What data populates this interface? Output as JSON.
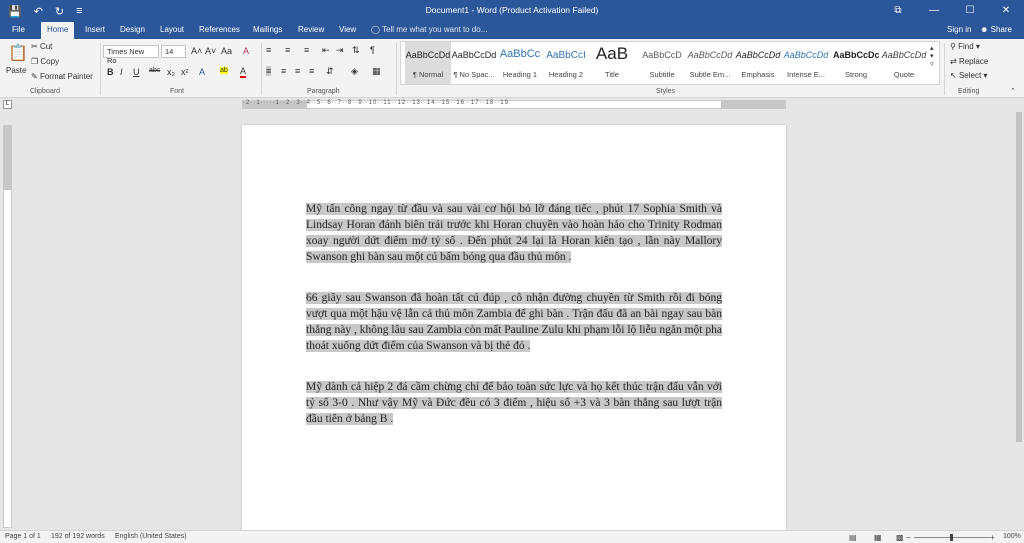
{
  "window": {
    "title": "Document1 - Word (Product Activation Failed)",
    "qat": {
      "save_icon": "💾",
      "undo_icon": "↶",
      "redo_icon": "↻",
      "customize_icon": "≡"
    },
    "controls": {
      "ribbon_display": "⧉",
      "minimize": "—",
      "maximize": "☐",
      "close": "✕"
    }
  },
  "tabs": [
    "File",
    "Home",
    "Insert",
    "Design",
    "Layout",
    "References",
    "Mailings",
    "Review",
    "View"
  ],
  "tell_me": "Tell me what you want to do...",
  "sign_in": "Sign in",
  "share": "Share",
  "clipboard": {
    "paste": "Paste",
    "cut": "Cut",
    "copy": "Copy",
    "format_painter": "Format Painter",
    "group": "Clipboard"
  },
  "font": {
    "name": "Times New Ro",
    "size": "14",
    "group": "Font",
    "bold": "B",
    "italic": "I",
    "underline": "U",
    "strike": "abc",
    "subscript": "x₂",
    "superscript": "x²",
    "grow": "A˄",
    "shrink": "A˅",
    "case": "Aa",
    "clear": "A",
    "effects": "A",
    "highlight": "ab",
    "color": "A"
  },
  "paragraph": {
    "group": "Paragraph",
    "show_marks": "¶"
  },
  "styles": {
    "group": "Styles",
    "items": [
      {
        "preview": "AaBbCcDd",
        "label": "¶ Normal"
      },
      {
        "preview": "AaBbCcDd",
        "label": "¶ No Spac..."
      },
      {
        "preview": "AaBbCc",
        "label": "Heading 1"
      },
      {
        "preview": "AaBbCcI",
        "label": "Heading 2"
      },
      {
        "preview": "AaB",
        "label": "Title"
      },
      {
        "preview": "AaBbCcD",
        "label": "Subtitle"
      },
      {
        "preview": "AaBbCcDd",
        "label": "Subtle Em..."
      },
      {
        "preview": "AaBbCcDd",
        "label": "Emphasis"
      },
      {
        "preview": "AaBbCcDd",
        "label": "Intense E..."
      },
      {
        "preview": "AaBbCcDc",
        "label": "Strong"
      },
      {
        "preview": "AaBbCcDd",
        "label": "Quote"
      }
    ]
  },
  "editing": {
    "group": "Editing",
    "find": "Find",
    "replace": "Replace",
    "select": "Select"
  },
  "ruler_numbers": "·2··1·····1··2··3··4··5··6··7··8··9··10··11··12··13··14··15··16··17··18··19",
  "document": {
    "paragraphs": [
      "Mỹ tấn công ngay từ đầu và sau vài cơ hội bỏ lỡ đáng tiếc , phút 17 Sophia Smith và Lindsay Horan đánh biên trái trước khi Horan chuyền vào hoàn hảo cho Trinity Rodman xoay người dứt điểm mở tỷ số . Đến phút 24 lại là Horan kiến tạo , lần này Mallory Swanson ghi bàn sau một cú bấm bóng qua đầu thủ môn .",
      "66 giây sau Swanson đã hoàn tất cú đúp , cô nhận đường chuyền từ Smith rồi đi bóng vượt qua một hậu vệ lẫn cả thủ môn Zambia để ghi bàn . Trận đấu đã an bài ngay sau bàn thắng này , không lâu sau Zambia còn mất Pauline Zulu khi phạm lỗi lộ liễu ngăn một pha thoát xuống dứt điểm của Swanson và bị thẻ đỏ .",
      "Mỹ dành cả hiệp 2 đá cầm chừng chỉ để bảo toàn sức lực và họ kết thúc trận đấu vẫn với tỷ số 3-0 . Như vậy Mỹ và Đức đều có 3 điểm , hiệu số +3 và 3 bàn thắng sau lượt trận đầu tiên ở bảng B ."
    ]
  },
  "status": {
    "page": "Page 1 of 1",
    "words": "192 of 192 words",
    "language": "English (United States)",
    "zoom": "100%"
  },
  "colors": {
    "accent": "#2b579a",
    "selection": "#c8c8c8"
  }
}
